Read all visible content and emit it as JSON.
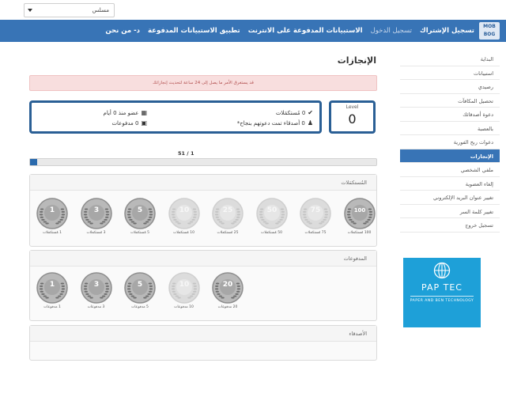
{
  "lang_select": {
    "value": "مسلس"
  },
  "logo": {
    "line1": "MOB",
    "line2": "BOG"
  },
  "nav": [
    {
      "label": "تسجيل الإشتراك",
      "muted": false
    },
    {
      "label": "تسجيل الدخول",
      "muted": true
    },
    {
      "label": "الاستبيانات المدفوعة على الانترنت",
      "muted": false
    },
    {
      "label": "تطبيق الاستبيانات المدفوعة",
      "muted": false
    },
    {
      "label": "د- من نحن",
      "muted": false
    }
  ],
  "sidebar": {
    "items": [
      {
        "label": "البداية",
        "active": false
      },
      {
        "label": "استبيانات",
        "active": false
      },
      {
        "label": "رصيدي",
        "active": false
      },
      {
        "label": "تحصيل المكافآت",
        "active": false
      },
      {
        "label": "دعوة أصدقائك",
        "active": false
      },
      {
        "label": "بالعصبة",
        "active": false
      },
      {
        "label": "دعوات ربح الفورية",
        "active": false
      },
      {
        "label": "الإنجازات",
        "active": true
      },
      {
        "label": "ملفي الشخصي",
        "active": false
      },
      {
        "label": "إلغاء العضوية",
        "active": false
      },
      {
        "label": "تغيير عنوان البريد الإلكتروني",
        "active": false
      },
      {
        "label": "تغيير كلمة السر",
        "active": false
      },
      {
        "label": "تسجيل خروج",
        "active": false
      }
    ]
  },
  "page": {
    "title": "الإنجازات",
    "alert": "قد يستغرق الأمر ما يصل إلى 24 ساعة لتحديث إنجازاتك"
  },
  "stats": {
    "completed": "0 مُستكمَلات",
    "member_since": "عضو منذ 0 أيام",
    "friends": "0 أصدقاء تمت دعوتهم بنجاح*",
    "payouts": "0 مدفوعات"
  },
  "level": {
    "label": "Level",
    "value": "0"
  },
  "progress": {
    "text": "51 / 1",
    "percent": 2
  },
  "sections": [
    {
      "title": "المُستكمَلات",
      "badges": [
        {
          "num": "1",
          "label": "1 مُستكمَلات",
          "earned": true
        },
        {
          "num": "3",
          "label": "3 مُستكمَلات",
          "earned": true
        },
        {
          "num": "5",
          "label": "5 مُستكمَلات",
          "earned": true
        },
        {
          "num": "10",
          "label": "10 مُستكمَلات",
          "earned": false
        },
        {
          "num": "25",
          "label": "25 مُستكمَلات",
          "earned": false
        },
        {
          "num": "50",
          "label": "50 مُستكمَلات",
          "earned": false
        },
        {
          "num": "75",
          "label": "75 مُستكمَلات",
          "earned": false
        },
        {
          "num": "100",
          "label": "100 مُستكمَلات",
          "earned": true
        }
      ]
    },
    {
      "title": "المدفوعات",
      "badges": [
        {
          "num": "1",
          "label": "1 مدفوعات",
          "earned": true
        },
        {
          "num": "3",
          "label": "3 مدفوعات",
          "earned": true
        },
        {
          "num": "5",
          "label": "5 مدفوعات",
          "earned": true
        },
        {
          "num": "10",
          "label": "10 مدفوعات",
          "earned": false
        },
        {
          "num": "20",
          "label": "20 مدفوعات",
          "earned": true
        }
      ]
    },
    {
      "title": "الأصدقاء",
      "badges": []
    }
  ],
  "ad": {
    "name": "PAP TEC",
    "subtitle": "PAPER AND BEN TECHNOLOGY"
  }
}
